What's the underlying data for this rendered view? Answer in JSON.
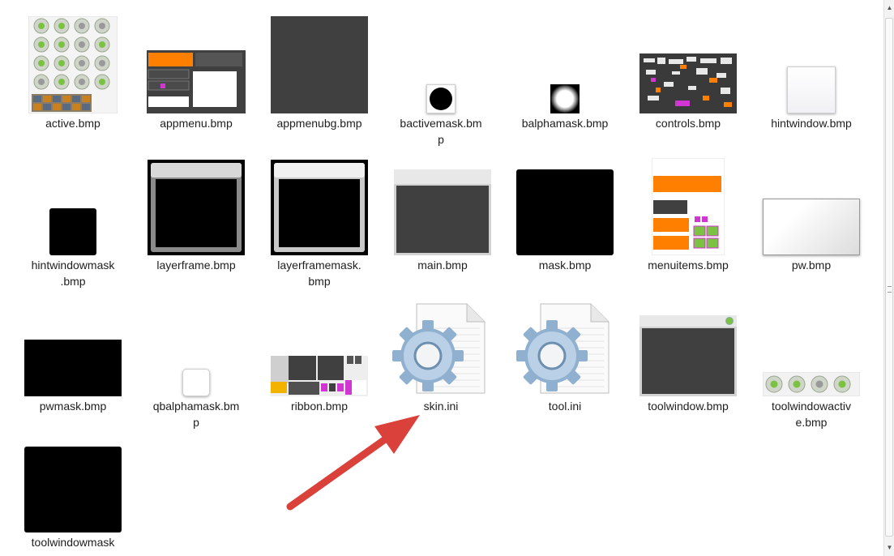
{
  "files": [
    {
      "name": "active.bmp",
      "icon": "image-thumbnail-icon"
    },
    {
      "name": "appmenu.bmp",
      "icon": "image-thumbnail-icon"
    },
    {
      "name": "appmenubg.bmp",
      "icon": "image-thumbnail-icon"
    },
    {
      "name": "bactivemask.bmp",
      "icon": "image-thumbnail-icon"
    },
    {
      "name": "balphamask.bmp",
      "icon": "image-thumbnail-icon"
    },
    {
      "name": "controls.bmp",
      "icon": "image-thumbnail-icon"
    },
    {
      "name": "hintwindow.bmp",
      "icon": "image-thumbnail-icon"
    },
    {
      "name": "hintwindowmask.bmp",
      "icon": "image-thumbnail-icon"
    },
    {
      "name": "layerframe.bmp",
      "icon": "image-thumbnail-icon"
    },
    {
      "name": "layerframemask.bmp",
      "icon": "image-thumbnail-icon"
    },
    {
      "name": "main.bmp",
      "icon": "image-thumbnail-icon"
    },
    {
      "name": "mask.bmp",
      "icon": "image-thumbnail-icon"
    },
    {
      "name": "menuitems.bmp",
      "icon": "image-thumbnail-icon"
    },
    {
      "name": "pw.bmp",
      "icon": "image-thumbnail-icon"
    },
    {
      "name": "pwmask.bmp",
      "icon": "image-thumbnail-icon"
    },
    {
      "name": "qbalphamask.bmp",
      "icon": "image-thumbnail-icon"
    },
    {
      "name": "ribbon.bmp",
      "icon": "image-thumbnail-icon"
    },
    {
      "name": "skin.ini",
      "icon": "settings-file-icon"
    },
    {
      "name": "tool.ini",
      "icon": "settings-file-icon"
    },
    {
      "name": "toolwindow.bmp",
      "icon": "image-thumbnail-icon"
    },
    {
      "name": "toolwindowactive.bmp",
      "icon": "image-thumbnail-icon"
    },
    {
      "name": "toolwindowmask.bmp",
      "icon": "image-thumbnail-icon"
    }
  ],
  "labels_display": [
    "active.bmp",
    "appmenu.bmp",
    "appmenubg.bmp",
    "bactivemask.bm\np",
    "balphamask.bmp",
    "controls.bmp",
    "hintwindow.bmp",
    "hintwindowmask\n.bmp",
    "layerframe.bmp",
    "layerframemask.\nbmp",
    "main.bmp",
    "mask.bmp",
    "menuitems.bmp",
    "pw.bmp",
    "pwmask.bmp",
    "qbalphamask.bm\np",
    "ribbon.bmp",
    "skin.ini",
    "tool.ini",
    "toolwindow.bmp",
    "toolwindowactiv\ne.bmp",
    "toolwindowmask"
  ],
  "annotation": {
    "type": "arrow",
    "color": "#d9413a",
    "target": "skin.ini"
  },
  "colors": {
    "orange": "#ff8000",
    "green": "#7cc242",
    "dark": "#3f3f3f",
    "black": "#000000"
  }
}
